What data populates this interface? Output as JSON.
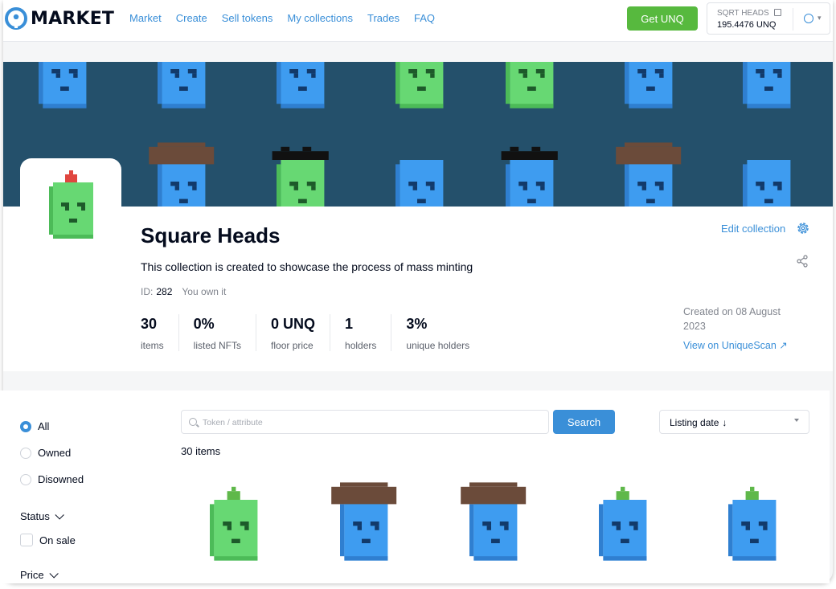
{
  "header": {
    "logo_text": "MARKET",
    "nav": [
      "Market",
      "Create",
      "Sell tokens",
      "My collections",
      "Trades",
      "FAQ"
    ],
    "get_button": "Get UNQ",
    "wallet": {
      "label": "SQRT HEADS",
      "balance": "195.4476 UNQ"
    }
  },
  "collection": {
    "title": "Square Heads",
    "description": "This collection is created to showcase the process of mass minting",
    "id_label": "ID:",
    "id_value": "282",
    "ownership": "You own it",
    "stats": [
      {
        "value": "30",
        "label": "items"
      },
      {
        "value": "0%",
        "label": "listed NFTs"
      },
      {
        "value": "0 UNQ",
        "label": "floor price"
      },
      {
        "value": "1",
        "label": "holders"
      },
      {
        "value": "3%",
        "label": "unique holders"
      }
    ],
    "edit_link": "Edit collection",
    "created": "Created on 08 August 2023",
    "scan_link": "View on UniqueScan ↗"
  },
  "filters": {
    "radios": [
      "All",
      "Owned",
      "Disowned"
    ],
    "selected": "All",
    "status_heading": "Status",
    "on_sale_label": "On sale",
    "price_heading": "Price"
  },
  "listing": {
    "search_placeholder": "Token / attribute",
    "search_button": "Search",
    "sort_label": "Listing date",
    "sort_arrow": "↓",
    "count_text": "30 items"
  },
  "colors": {
    "accent": "#3a8fd8",
    "get_button": "#57b93e",
    "banner": "#24506b",
    "head_blue": "#3e9cf0",
    "head_green": "#67d873"
  }
}
